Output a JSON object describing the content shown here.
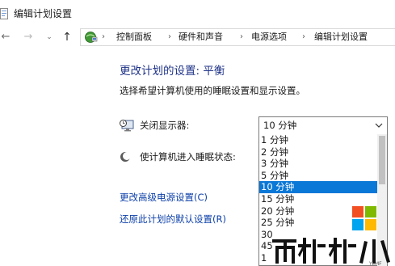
{
  "window": {
    "title": "编辑计划设置"
  },
  "nav": {
    "back": "←",
    "forward": "→",
    "recent": "⌄",
    "up": "↑"
  },
  "breadcrumb": [
    "控制面板",
    "硬件和声音",
    "电源选项",
    "编辑计划设置"
  ],
  "breadcrumb_separator": "›",
  "main": {
    "heading": "更改计划的设置: 平衡",
    "description": "选择希望计算机使用的睡眠设置和显示设置。",
    "display_label": "关闭显示器:",
    "display_value": "10 分钟",
    "sleep_label": "使计算机进入睡眠状态:",
    "advanced_link": "更改高级电源设置(C)",
    "restore_link": "还原此计划的默认设置(R)"
  },
  "dropdown": {
    "options": [
      "1 分钟",
      "2 分钟",
      "3 分钟",
      "5 分钟",
      "10 分钟",
      "15 分钟",
      "20 分钟",
      "25 分钟",
      "30",
      "45",
      "1"
    ],
    "selected_index": 4
  },
  "colors": {
    "heading": "#1e3287",
    "link": "#0b3fa8",
    "selection": "#0a78d7"
  },
  "icons": {
    "title": "document-icon",
    "address": "control-panel-icon",
    "display": "monitor-clock-icon",
    "sleep": "moon-icon",
    "dropdown": "chevron-down-icon"
  }
}
